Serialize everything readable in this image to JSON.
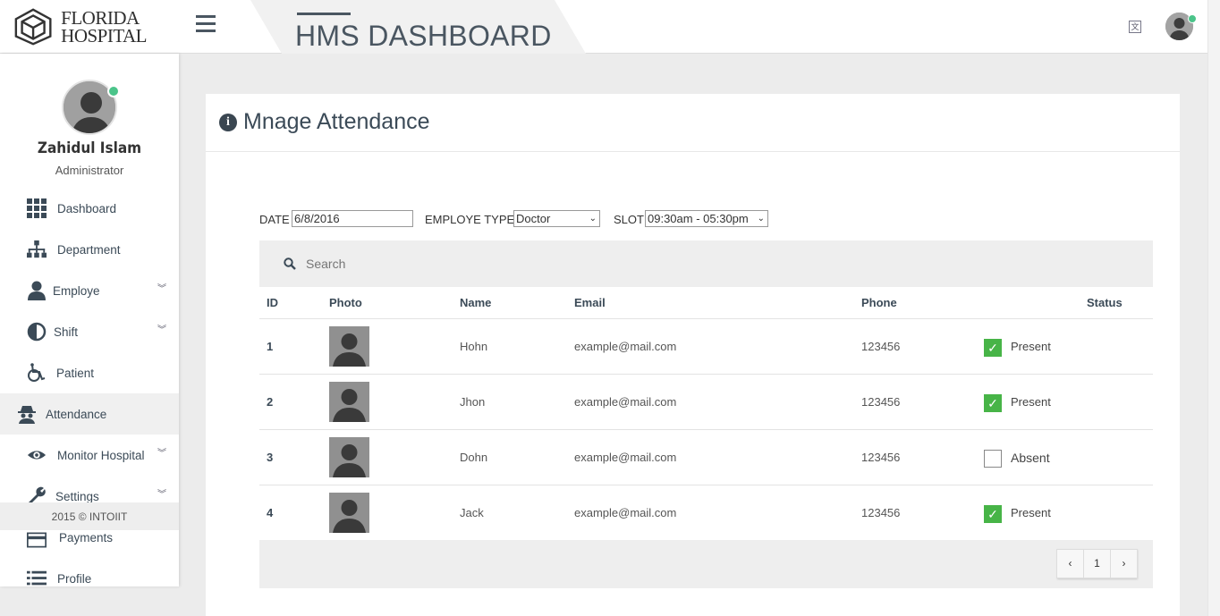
{
  "header": {
    "logo_line1": "FLORIDA",
    "logo_line2": "HOSPITAL",
    "title": "HMS DASHBOARD",
    "lang_icon": "translate-icon"
  },
  "sidebar": {
    "user_name": "Zahidul Islam",
    "user_role": "Administrator",
    "items": [
      {
        "label": "Dashboard",
        "icon": "grid-icon"
      },
      {
        "label": "Department",
        "icon": "sitemap-icon"
      },
      {
        "label": "Employe",
        "icon": "user-icon",
        "has_submenu": true
      },
      {
        "label": "Shift",
        "icon": "half-circle-icon",
        "has_submenu": true
      },
      {
        "label": "Patient",
        "icon": "wheelchair-icon"
      },
      {
        "label": "Attendance",
        "icon": "spy-icon",
        "active": true
      },
      {
        "label": "Monitor Hospital",
        "icon": "eye-icon",
        "has_submenu": true
      },
      {
        "label": "Settings",
        "icon": "wrench-icon",
        "has_submenu": true
      },
      {
        "label": "Payments",
        "icon": "credit-card-icon"
      },
      {
        "label": "Profile",
        "icon": "list-icon"
      }
    ],
    "footer": "2015 © INTOIIT"
  },
  "main": {
    "title": "Mnage Attendance",
    "filters": {
      "date_label": "DATE",
      "date_value": "6/8/2016",
      "type_label": "EMPLOYE TYPE",
      "type_value": "Doctor",
      "slot_label": "SLOT",
      "slot_value": "09:30am - 05:30pm"
    },
    "search_placeholder": "Search",
    "columns": [
      "ID",
      "Photo",
      "Name",
      "Email",
      "Phone",
      "Status"
    ],
    "rows": [
      {
        "id": "1",
        "name": "Hohn",
        "email": "example@mail.com",
        "phone": "123456",
        "present": true,
        "status": "Present"
      },
      {
        "id": "2",
        "name": "Jhon",
        "email": "example@mail.com",
        "phone": "123456",
        "present": true,
        "status": "Present"
      },
      {
        "id": "3",
        "name": "Dohn",
        "email": "example@mail.com",
        "phone": "123456",
        "present": false,
        "status": "Absent"
      },
      {
        "id": "4",
        "name": "Jack",
        "email": "example@mail.com",
        "phone": "123456",
        "present": true,
        "status": "Present"
      }
    ],
    "pagination": {
      "prev": "‹",
      "page": "1",
      "next": "›"
    }
  },
  "colors": {
    "accent_dark": "#3b4a57",
    "online_green": "#4bc48a",
    "check_green": "#47b447"
  }
}
